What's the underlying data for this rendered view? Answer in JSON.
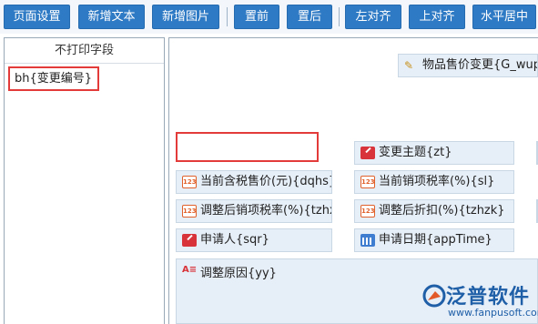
{
  "toolbar": {
    "buttons": [
      "页面设置",
      "新增文本",
      "新增图片",
      "置前",
      "置后",
      "左对齐",
      "上对齐",
      "水平居中"
    ]
  },
  "left_panel": {
    "title": "不打印字段",
    "items": [
      "bh{变更编号}"
    ]
  },
  "canvas": {
    "header_field": "物品售价变更{G_wupi",
    "fields": {
      "change_subject": "变更主题{zt}",
      "price_incl_tax": "当前含税售价(元){dqhs}",
      "current_tax_rate": "当前销项税率(%){sl}",
      "adjusted_tax_rate": "调整后销项税率(%){tzhx}",
      "adjusted_discount": "调整后折扣(%){tzhzk}",
      "applicant": "申请人{sqr}",
      "apply_date": "申请日期{appTime}",
      "reason": "调整原因{yy}"
    }
  },
  "logo": {
    "name": "泛普软件",
    "url": "www.fanpusoft.com"
  },
  "colors": {
    "toolbar_button": "#2f7ac4",
    "field_bg": "#e6eef7",
    "highlight_border": "#e33a3a"
  }
}
